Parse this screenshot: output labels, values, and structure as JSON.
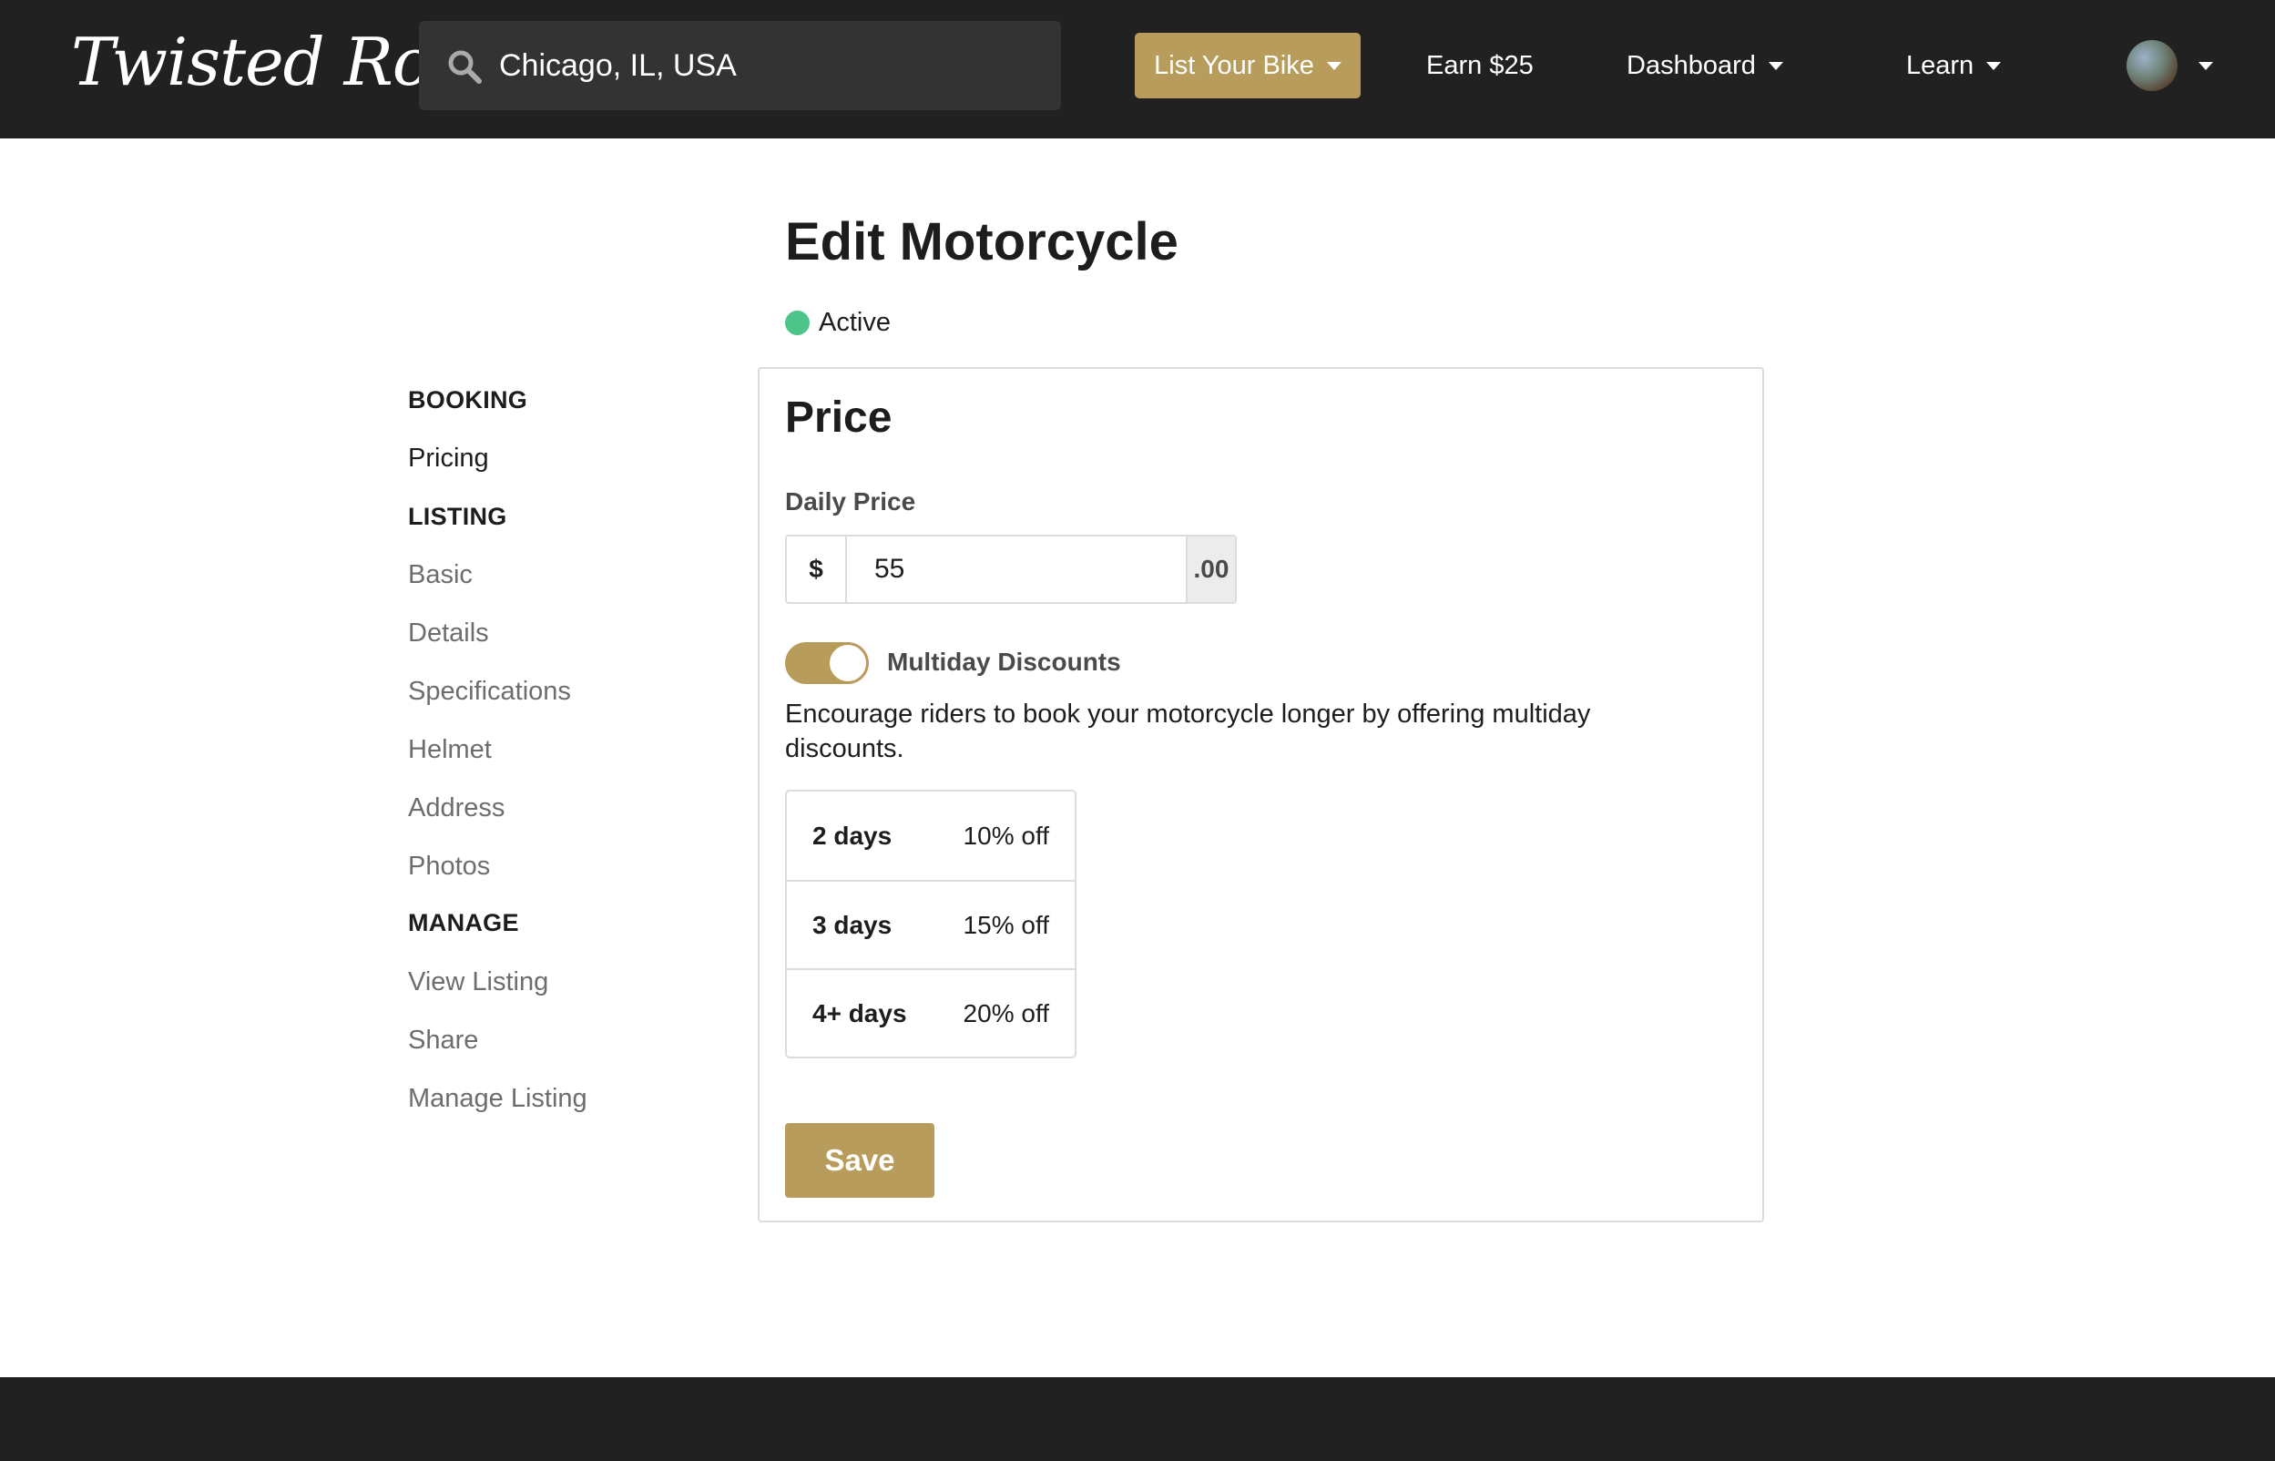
{
  "brand": {
    "logo_text": "Twisted Road",
    "accent_color": "#b89c5b",
    "active_color": "#4cc48a"
  },
  "header": {
    "search_value": "Chicago, IL, USA",
    "list_bike_label": "List Your Bike",
    "earn_label": "Earn $25",
    "dashboard_label": "Dashboard",
    "learn_label": "Learn"
  },
  "sidebar": {
    "booking_heading": "BOOKING",
    "pricing": "Pricing",
    "listing_heading": "LISTING",
    "basic": "Basic",
    "details": "Details",
    "specifications": "Specifications",
    "helmet": "Helmet",
    "address": "Address",
    "photos": "Photos",
    "manage_heading": "MANAGE",
    "view_listing": "View Listing",
    "share": "Share",
    "manage_listing": "Manage Listing"
  },
  "main": {
    "title": "Edit Motorcycle",
    "status": "Active"
  },
  "price_panel": {
    "title": "Price",
    "daily_price_label": "Daily Price",
    "currency_prefix": "$",
    "daily_price_value": "55",
    "cents_suffix": ".00",
    "multiday_label": "Multiday Discounts",
    "multiday_enabled": true,
    "description": "Encourage riders to book your motorcycle longer by offering multiday discounts.",
    "discounts": [
      {
        "days": "2 days",
        "off": "10% off"
      },
      {
        "days": "3 days",
        "off": "15% off"
      },
      {
        "days": "4+ days",
        "off": "20% off"
      }
    ],
    "save_label": "Save"
  }
}
